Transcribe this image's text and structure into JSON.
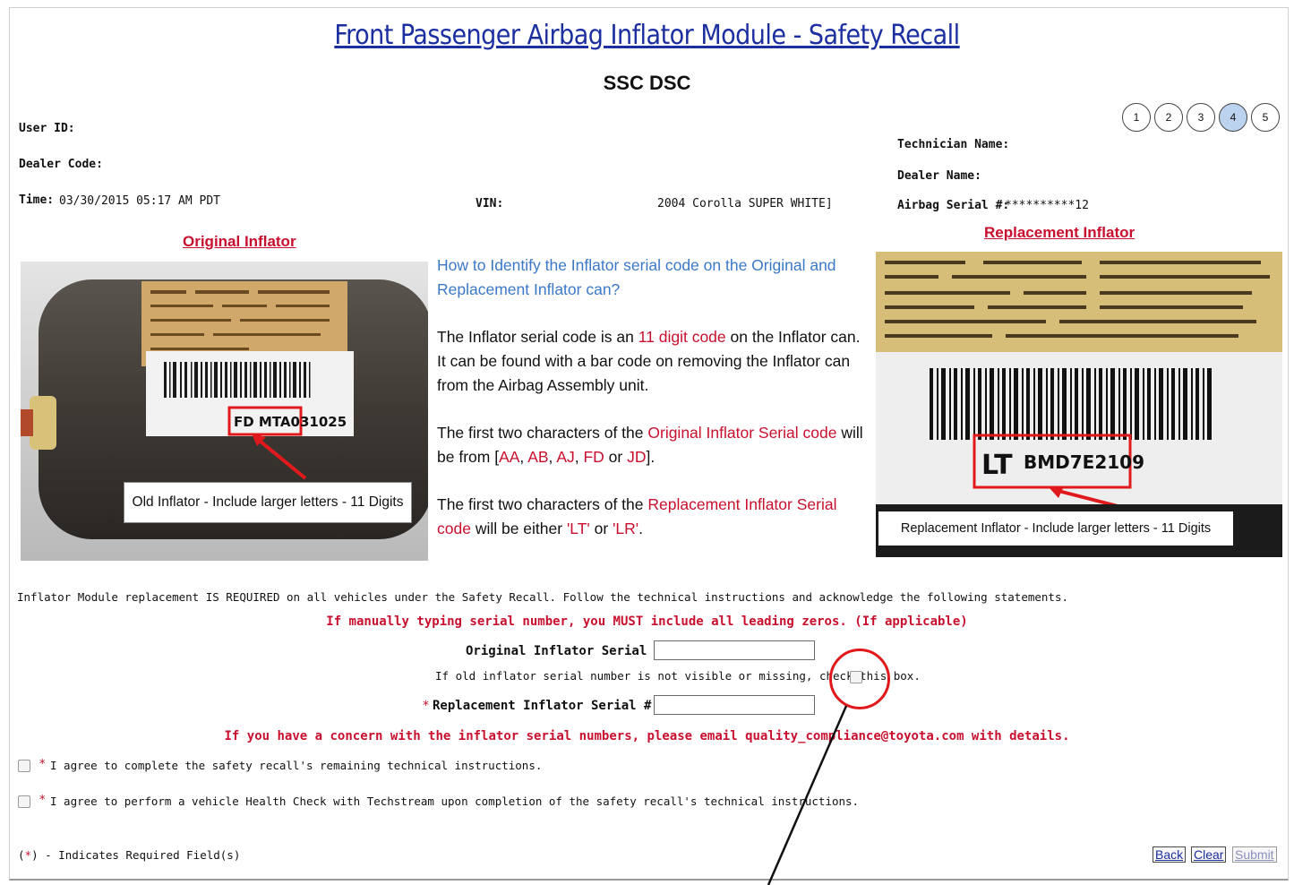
{
  "page": {
    "title": "Front Passenger Airbag Inflator Module - Safety Recall",
    "subtitle": "SSC DSC"
  },
  "steps": [
    {
      "label": "1",
      "active": false
    },
    {
      "label": "2",
      "active": false
    },
    {
      "label": "3",
      "active": false
    },
    {
      "label": "4",
      "active": true
    },
    {
      "label": "5",
      "active": false
    }
  ],
  "fields": {
    "user_id_label": "User ID:",
    "dealer_code_label": "Dealer Code:",
    "time_label": "Time:",
    "time_value": "03/30/2015 05:17 AM PDT",
    "vin_label": "VIN:",
    "vehicle_value": "2004 Corolla SUPER WHITE]",
    "technician_name_label": "Technician Name:",
    "dealer_name_label": "Dealer Name:",
    "airbag_serial_label": "Airbag Serial #:",
    "airbag_serial_value": "**********12"
  },
  "original": {
    "heading": "Original Inflator",
    "caption": "Old Inflator - Include larger letters - 11 Digits",
    "code": "FD MTA031025"
  },
  "replacement": {
    "heading": "Replacement Inflator",
    "caption": "Replacement Inflator - Include larger letters - 11 Digits",
    "code_prefix": "LT",
    "code": "BMD7E2109"
  },
  "info": {
    "question": "How to Identify the Inflator serial code on the Original and Replacement Inflator can?",
    "p1_a": "The Inflator serial code is an ",
    "p1_red": "11 digit code",
    "p1_b": " on the Inflator can. It can be found with a bar code on removing the Inflator can from the Airbag Assembly unit.",
    "p2_a": "The first two characters of the ",
    "p2_red": "Original Inflator Serial code",
    "p2_b": " will be from [",
    "p2_c1": "AA",
    "p2_c2": "AB",
    "p2_c3": "AJ",
    "p2_c4": "FD",
    "p2_or": " or ",
    "p2_c5": "JD",
    "p2_end": "].",
    "p3_a": "The first two characters of the ",
    "p3_red": "Replacement Inflator Serial code",
    "p3_b": " will be either ",
    "p3_c1": "'LT'",
    "p3_or": " or ",
    "p3_c2": "'LR'",
    "p3_end": "."
  },
  "form": {
    "requirement": "Inflator Module replacement IS REQUIRED on all vehicles under the Safety Recall. Follow the technical instructions and acknowledge the following statements.",
    "zeros_warning": "If manually typing serial number, you MUST include all leading zeros. (If applicable)",
    "original_serial_label": "Original Inflator Serial #:",
    "original_serial_value": "",
    "missing_checkbox_label": "If old inflator serial number is not visible or missing, check this box.",
    "replacement_serial_label": "Replacement Inflator Serial #:",
    "replacement_serial_value": "",
    "concern": "If you have a concern with the inflator serial numbers, please email quality_compliance@toyota.com with details.",
    "agree1": "I agree to complete the safety recall's remaining technical instructions.",
    "agree2": "I agree to perform a vehicle Health Check with Techstream upon completion of the safety recall's technical instructions.",
    "asterisk": "*",
    "required_note_prefix": "(",
    "required_note_star": "*",
    "required_note_suffix": ") - Indicates Required Field(s)"
  },
  "buttons": {
    "back": "Back",
    "clear": "Clear",
    "submit": "Submit"
  },
  "colors": {
    "title_blue": "#1c2fa0",
    "accent_red": "#c8102e",
    "question_blue": "#3b78c9",
    "step_active": "#bcd3f0"
  }
}
